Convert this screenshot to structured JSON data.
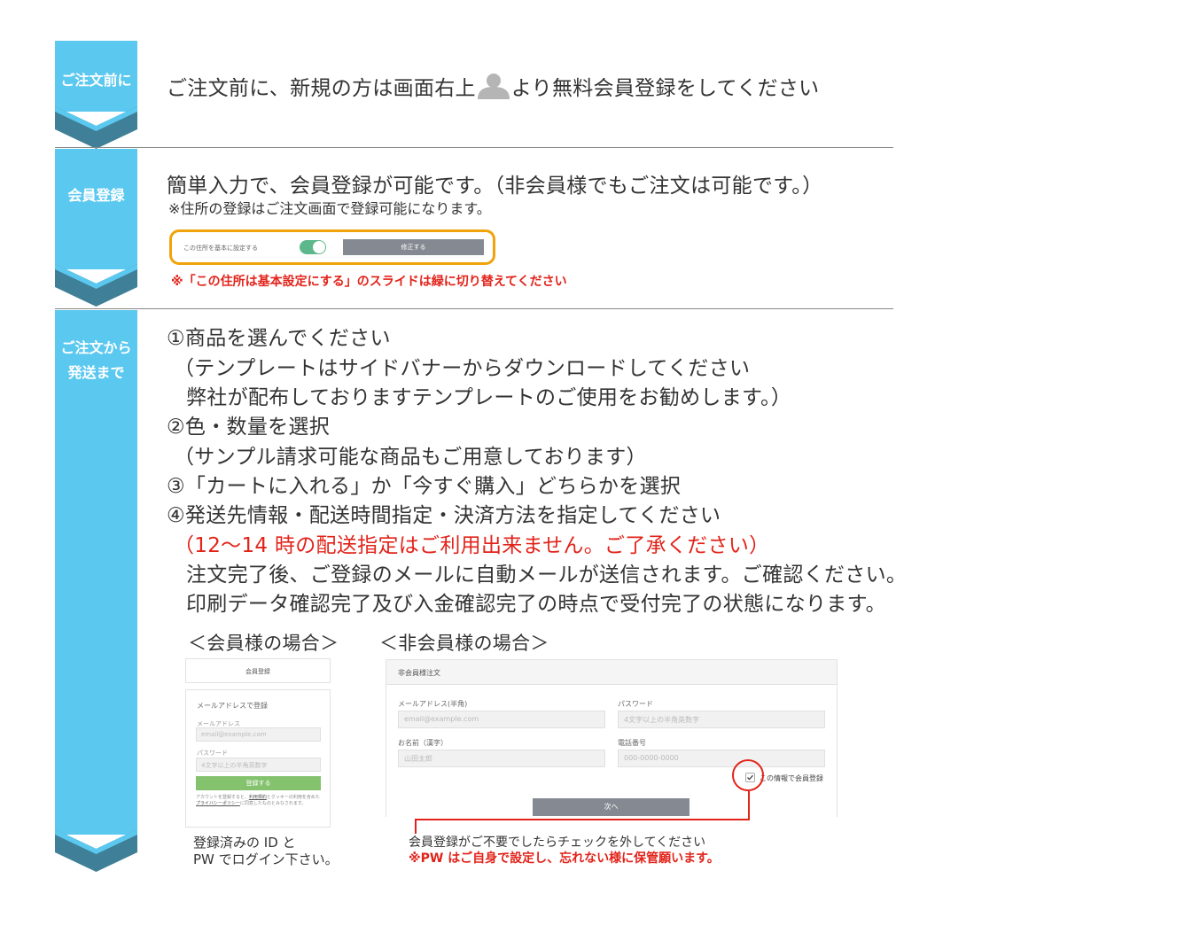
{
  "steps": [
    {
      "label": "ご注文前に"
    },
    {
      "label": "会員登録"
    },
    {
      "label_line1": "ご注文から",
      "label_line2": "発送まで"
    }
  ],
  "intro": {
    "before_icon": "ご注文前に、新規の方は画面右上",
    "icon": "user-icon",
    "after_icon": "より無料会員登録をしてください"
  },
  "register": {
    "heading": "簡単入力で、会員登録が可能です。（非会員様でもご注文は可能です。）",
    "note": "※住所の登録はご注文画面で登録可能になります。",
    "toggle_label": "この住所を基本に設定する",
    "toggle_on": true,
    "edit_button": "修正する",
    "warning": "※「この住所は基本設定にする」のスライドは緑に切り替えてください"
  },
  "order_steps": {
    "lines": [
      "①商品を選んでください",
      "（テンプレートはサイドバナーからダウンロードしてください",
      "弊社が配布しておりますテンプレートのご使用をお勧めします。）",
      "②色・数量を選択",
      "（サンプル請求可能な商品もご用意しております）",
      "③「カートに入れる」か「今すぐ購入」どちらかを選択",
      "④発送先情報・配送時間指定・決済方法を指定してください"
    ],
    "red_line": "（12〜14 時の配送指定はご利用出来ません。ご了承ください）",
    "after_lines": [
      "注文完了後、ご登録のメールに自動メールが送信されます。ご確認ください。",
      "印刷データ確認完了及び入金確認完了の時点で受付完了の状態になります。"
    ]
  },
  "member_case": {
    "title": "＜会員様の場合＞",
    "panel_title": "会員登録",
    "section_title": "メールアドレスで登録",
    "email_label": "メールアドレス",
    "email_placeholder": "email@example.com",
    "password_label": "パスワード",
    "password_placeholder": "4文字以上の半角英数字",
    "register_button": "登録する",
    "terms_prefix": "アカウントを登録すると、",
    "terms_link": "利用規約",
    "terms_mid": "とクッキーの利用を含めた",
    "privacy_link": "プライバシーポリシー",
    "terms_suffix": "に同意したものとみなされます。",
    "caption_line1": "登録済みの ID と",
    "caption_line2": "PW でログイン下さい。"
  },
  "guest_case": {
    "title": "＜非会員様の場合＞",
    "panel_title": "非会員様注文",
    "email_label": "メールアドレス(半角)",
    "email_placeholder": "email@example.com",
    "password_label": "パスワード",
    "password_placeholder": "4文字以上の半角英数字",
    "name_label": "お名前（漢字）",
    "name_placeholder": "山田太郎",
    "phone_label": "電話番号",
    "phone_placeholder": "000-0000-0000",
    "checkbox_label": "この情報で会員登録",
    "checkbox_checked": true,
    "next_button": "次へ",
    "caption_line1": "会員登録がご不要でしたらチェックを外してください",
    "caption_line2": "※PW はご自身で設定し、忘れない様に保管願います。"
  },
  "colors": {
    "step_blue": "#5bc8ef",
    "chevron_dark": "#3f7f97",
    "toggle_green": "#5cb88a",
    "register_green": "#84c26e",
    "button_gray": "#858a92",
    "highlight_orange": "#f0a30a",
    "warning_red": "#e2231a"
  }
}
